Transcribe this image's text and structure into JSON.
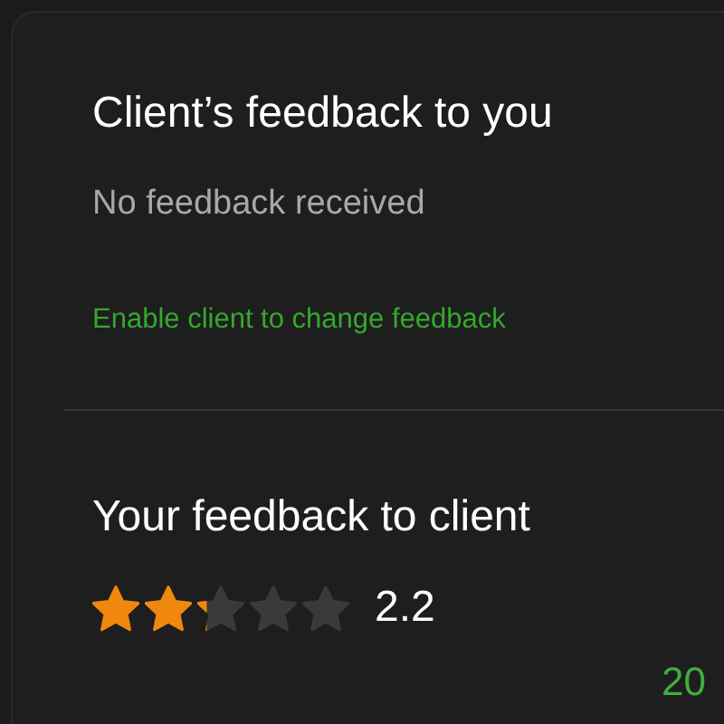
{
  "client_feedback": {
    "title": "Client’s feedback to you",
    "status": "No feedback received",
    "link": "Enable client to change feedback"
  },
  "your_feedback": {
    "title": "Your feedback to client",
    "stars": 2.2,
    "reading": "2.2"
  },
  "corner_label": "20"
}
